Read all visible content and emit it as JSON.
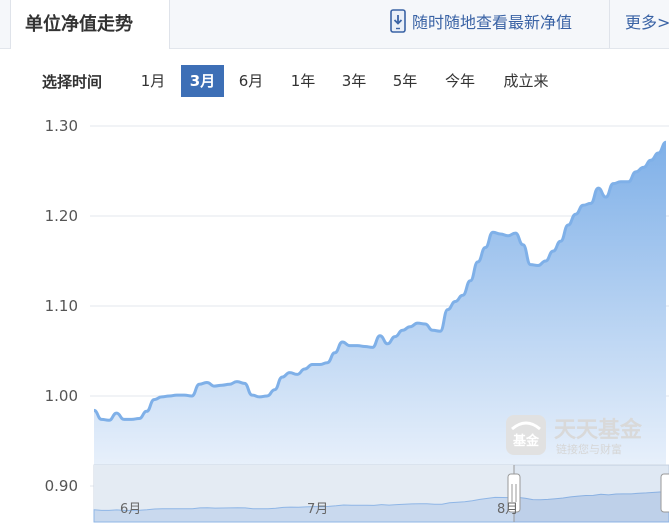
{
  "header": {
    "tab_title": "单位净值走势",
    "mobile_link": "随时随地查看最新净值",
    "more_link": "更多>"
  },
  "time_range": {
    "label": "选择时间",
    "options": [
      "1月",
      "3月",
      "6月",
      "1年",
      "3年",
      "5年",
      "今年",
      "成立来"
    ],
    "selected": "3月"
  },
  "watermark": {
    "text": "天天基金",
    "sub": "链接您与财富",
    "logo": "基金"
  },
  "colors": {
    "line": "#7fb0e8",
    "area_top": "#7fb0e8",
    "area_bottom": "#f2f7fd",
    "active_tab": "#3d6fb6",
    "link": "#3a63a5"
  },
  "chart_data": {
    "type": "area",
    "title": "",
    "xlabel": "",
    "ylabel": "",
    "ylim": [
      0.9,
      1.3
    ],
    "yticks": [
      "1.30",
      "1.20",
      "1.10",
      "1.00",
      "0.90"
    ],
    "grid": true,
    "navigator_labels": [
      "6月",
      "7月",
      "8月"
    ],
    "series": [
      {
        "values": [
          0.984,
          0.974,
          0.973,
          0.981,
          0.974,
          0.974,
          0.975,
          0.983,
          0.996,
          0.999,
          1.0,
          1.001,
          1.001,
          1.0,
          1.013,
          1.015,
          1.011,
          1.012,
          1.013,
          1.016,
          1.014,
          1.001,
          0.999,
          1.0,
          1.007,
          1.021,
          1.026,
          1.024,
          1.03,
          1.035,
          1.035,
          1.037,
          1.048,
          1.06,
          1.056,
          1.056,
          1.055,
          1.054,
          1.067,
          1.058,
          1.066,
          1.073,
          1.077,
          1.081,
          1.08,
          1.073,
          1.072,
          1.096,
          1.105,
          1.112,
          1.128,
          1.149,
          1.165,
          1.182,
          1.18,
          1.178,
          1.181,
          1.168,
          1.146,
          1.145,
          1.15,
          1.161,
          1.172,
          1.19,
          1.202,
          1.212,
          1.214,
          1.231,
          1.221,
          1.236,
          1.238,
          1.238,
          1.249,
          1.254,
          1.262,
          1.27,
          1.282
        ]
      }
    ]
  }
}
